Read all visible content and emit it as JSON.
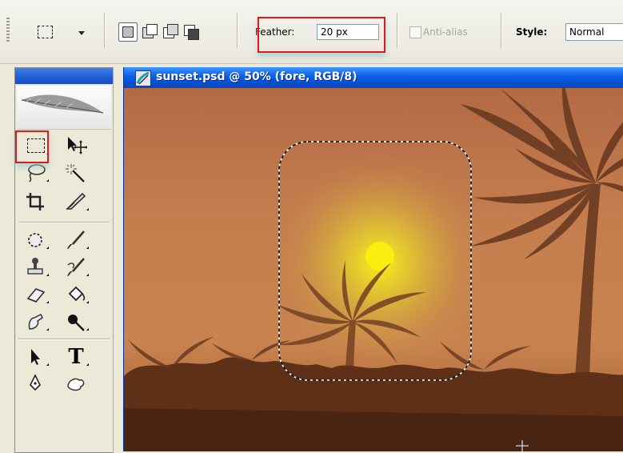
{
  "options_bar": {
    "feather_label": "Feather:",
    "feather_value": "20 px",
    "antialias_label": "Anti-alias",
    "style_label": "Style:",
    "style_value": "Normal"
  },
  "document": {
    "title": "sunset.psd @ 50% (fore, RGB/8)"
  },
  "tools": {
    "type_letter": "T"
  },
  "colors": {
    "highlight_box": "#e01a1a",
    "sky": "#c0784d",
    "sun": "#f4e21a"
  }
}
